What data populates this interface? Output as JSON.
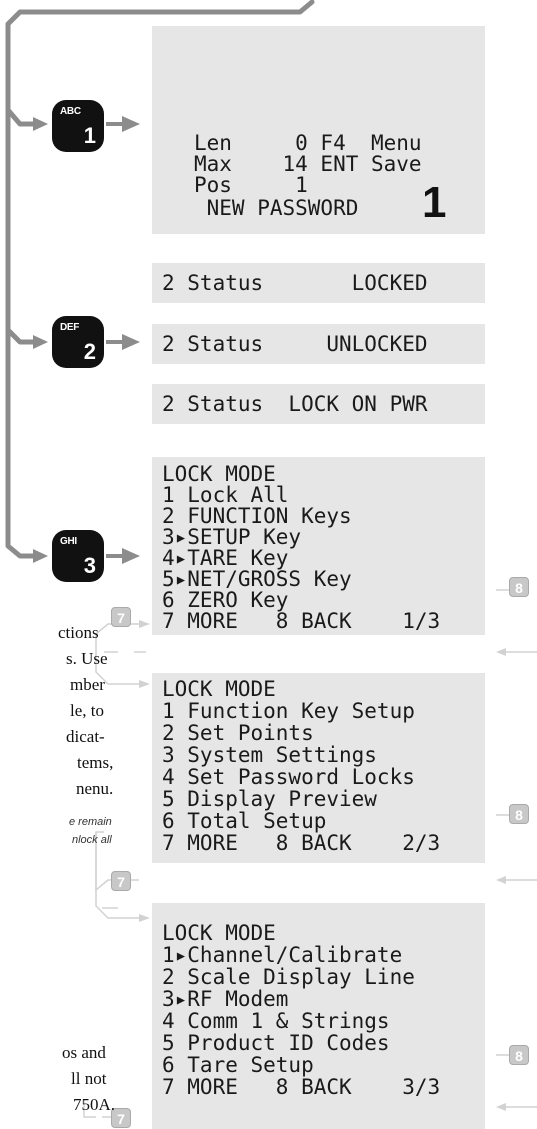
{
  "keys": [
    {
      "sub": "ABC",
      "num": "1"
    },
    {
      "sub": "DEF",
      "num": "2"
    },
    {
      "sub": "GHI",
      "num": "3"
    }
  ],
  "password_screen": {
    "lines": [
      "Len     0 F4  Menu",
      "Max    14 ENT Save",
      "Pos     1"
    ],
    "title": " NEW PASSWORD",
    "big_digit": "1"
  },
  "status_screens": [
    "2 Status       LOCKED",
    "2 Status     UNLOCKED",
    "2 Status  LOCK ON PWR"
  ],
  "lock_mode_pages": [
    {
      "lines": [
        "LOCK MODE",
        "1 Lock All",
        "2 FUNCTION Keys",
        "3▸SETUP Key",
        "4▸TARE Key",
        "5▸NET/GROSS Key",
        "6 ZERO Key",
        "7 MORE   8 BACK    1/3"
      ]
    },
    {
      "lines": [
        "LOCK MODE",
        "1 Function Key Setup",
        "2 Set Points",
        "3 System Settings",
        "4 Set Password Locks",
        "5 Display Preview",
        "6 Total Setup",
        "7 MORE   8 BACK    2/3"
      ]
    },
    {
      "lines": [
        "LOCK MODE",
        "1▸Channel/Calibrate",
        "2 Scale Display Line",
        "3▸RF Modem",
        "4 Comm 1 & Strings",
        "5 Product ID Codes",
        "6 Tare Setup",
        "7 MORE   8 BACK    3/3"
      ]
    }
  ],
  "badges": {
    "more": "7",
    "back": "8"
  },
  "side_text": {
    "para1": [
      "ctions",
      "s. Use",
      "mber",
      "le, to",
      "dicat-",
      "tems,",
      "nenu."
    ],
    "note": [
      "e remain",
      "nlock all"
    ],
    "para2": [
      "os and",
      "ll not",
      "750A."
    ]
  }
}
